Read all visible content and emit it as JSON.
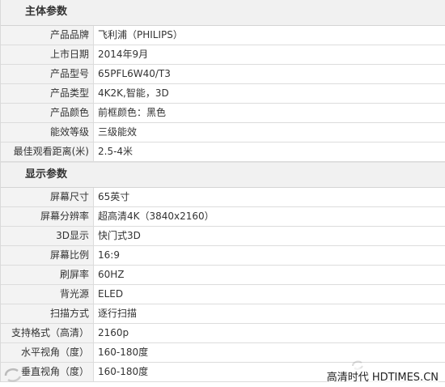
{
  "sections": [
    {
      "title": "主体参数",
      "rows": [
        {
          "label": "产品品牌",
          "value": "飞利浦（PHILIPS）"
        },
        {
          "label": "上市日期",
          "value": "2014年9月"
        },
        {
          "label": "产品型号",
          "value": "65PFL6W40/T3"
        },
        {
          "label": "产品类型",
          "value": "4K2K,智能，3D"
        },
        {
          "label": "产品颜色",
          "value": "前框颜色：黑色"
        },
        {
          "label": "能效等级",
          "value": "三级能效"
        },
        {
          "label": "最佳观看距离(米)",
          "value": "2.5-4米"
        }
      ]
    },
    {
      "title": "显示参数",
      "rows": [
        {
          "label": "屏幕尺寸",
          "value": "65英寸"
        },
        {
          "label": "屏幕分辨率",
          "value": "超高清4K（3840x2160）"
        },
        {
          "label": "3D显示",
          "value": "快门式3D"
        },
        {
          "label": "屏幕比例",
          "value": "16:9"
        },
        {
          "label": "刷屏率",
          "value": "60HZ"
        },
        {
          "label": "背光源",
          "value": "ELED"
        },
        {
          "label": "扫描方式",
          "value": "逐行扫描"
        },
        {
          "label": "支持格式（高清）",
          "value": "2160p"
        },
        {
          "label": "水平视角（度）",
          "value": "160-180度"
        },
        {
          "label": "垂直视角（度）",
          "value": "160-180度"
        }
      ]
    }
  ],
  "watermark": {
    "text": "高清时代 HDTIMES.CN",
    "icon": "hdtimes-logo-icon"
  }
}
